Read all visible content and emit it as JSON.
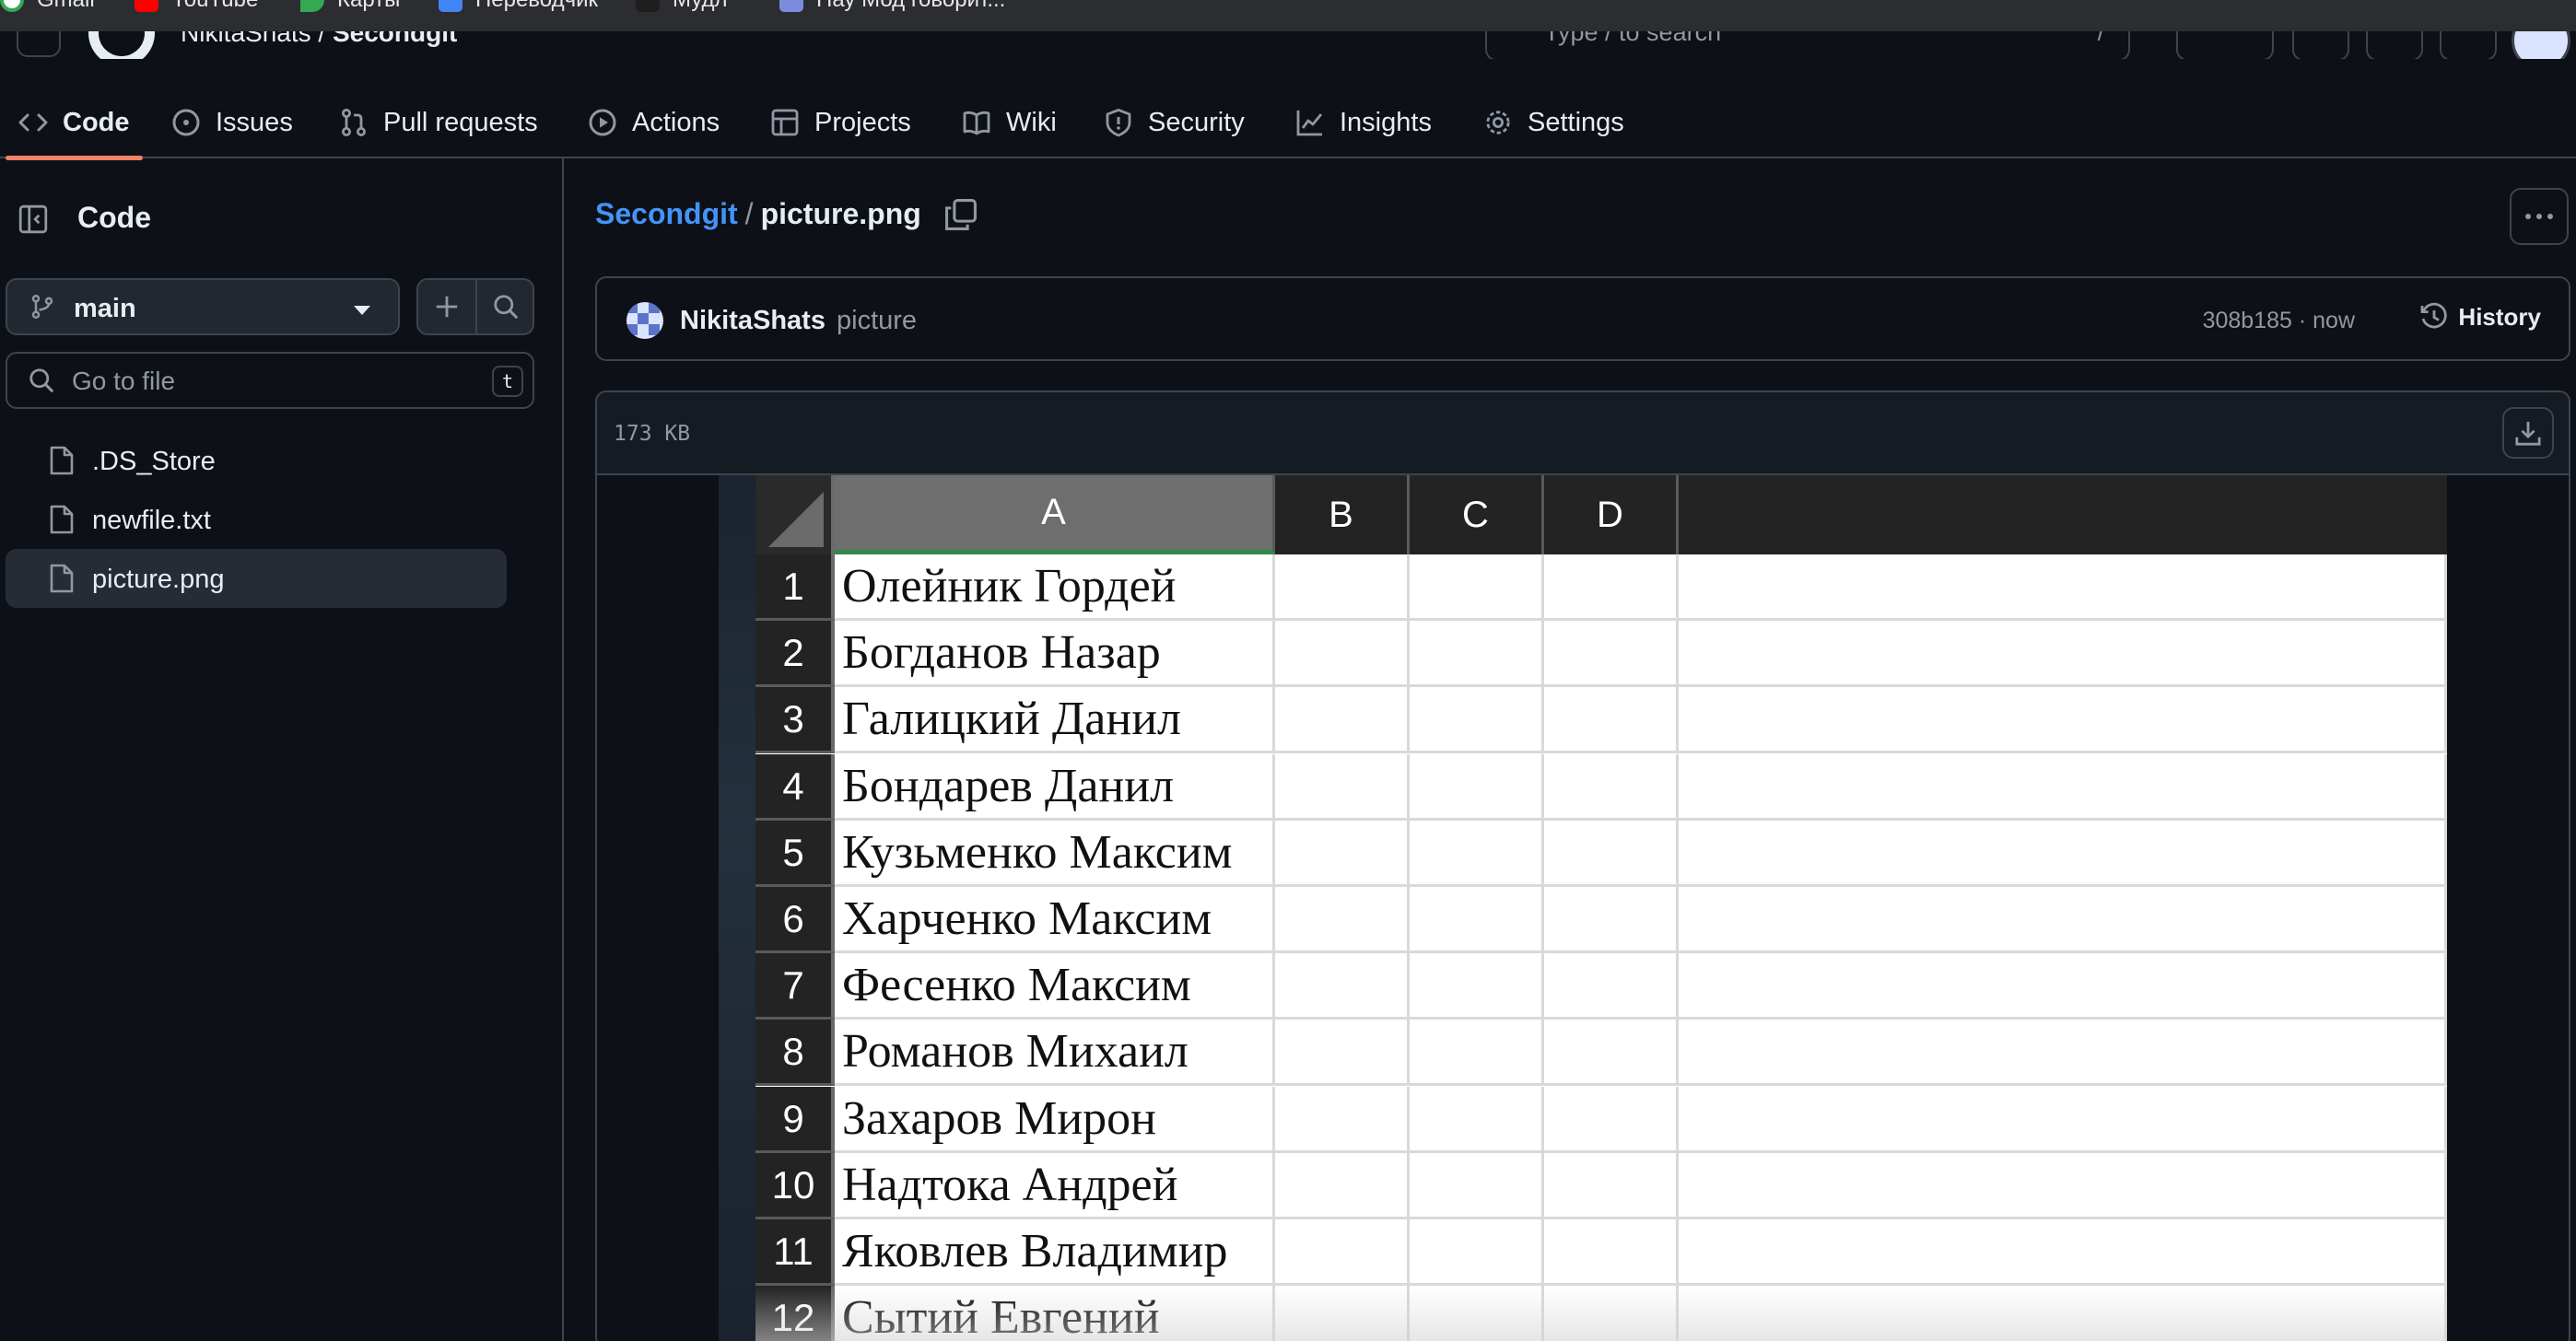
{
  "bookmarks": [
    {
      "label": "Gmail",
      "color": "#ffffff"
    },
    {
      "label": "YouTube",
      "color": "#ff0000"
    },
    {
      "label": "Карты",
      "color": "#34a853"
    },
    {
      "label": "Переводчик",
      "color": "#4285f4"
    },
    {
      "label": "Мудл",
      "color": "#1e1e1e"
    },
    {
      "label": "Нау Мод говорит...",
      "color": "#7b8cde"
    }
  ],
  "header": {
    "owner": "NikitaShats",
    "separator": "/",
    "repo": "Secondgit",
    "search_placeholder": "Type / to search",
    "search_shortcut": "/"
  },
  "repo_nav": {
    "tabs": [
      {
        "label": "Code",
        "icon": "code-icon",
        "active": true
      },
      {
        "label": "Issues",
        "icon": "issue-icon"
      },
      {
        "label": "Pull requests",
        "icon": "pull-request-icon"
      },
      {
        "label": "Actions",
        "icon": "play-icon"
      },
      {
        "label": "Projects",
        "icon": "table-icon"
      },
      {
        "label": "Wiki",
        "icon": "book-icon"
      },
      {
        "label": "Security",
        "icon": "shield-icon"
      },
      {
        "label": "Insights",
        "icon": "graph-icon"
      },
      {
        "label": "Settings",
        "icon": "gear-icon"
      }
    ]
  },
  "sidebar": {
    "title": "Code",
    "branch": "main",
    "goto_placeholder": "Go to file",
    "goto_shortcut": "t",
    "files": [
      {
        "name": ".DS_Store",
        "selected": false
      },
      {
        "name": "newfile.txt",
        "selected": false
      },
      {
        "name": "picture.png",
        "selected": true
      }
    ]
  },
  "main": {
    "repo_link": "Secondgit",
    "path_separator": "/",
    "file_name": "picture.png",
    "commit": {
      "author": "NikitaShats",
      "message": "picture",
      "meta": "308b185 · now",
      "history_label": "History"
    },
    "file_size": "173 KB"
  },
  "picture": {
    "columns": [
      "A",
      "B",
      "C",
      "D"
    ],
    "selected_column": "A",
    "rows": [
      {
        "num": "1",
        "name": "Олейник Гордей"
      },
      {
        "num": "2",
        "name": "Богданов Назар"
      },
      {
        "num": "3",
        "name": "Галицкий Данил"
      },
      {
        "num": "4",
        "name": "Бондарев Данил"
      },
      {
        "num": "5",
        "name": "Кузьменко Максим"
      },
      {
        "num": "6",
        "name": "Харченко Максим"
      },
      {
        "num": "7",
        "name": "Фесенко Максим"
      },
      {
        "num": "8",
        "name": "Романов Михаил"
      },
      {
        "num": "9",
        "name": "Захаров Мирон"
      },
      {
        "num": "10",
        "name": "Надтока Андрей"
      },
      {
        "num": "11",
        "name": "Яковлев Владимир"
      },
      {
        "num": "12",
        "name": "Сытий Евгений"
      }
    ]
  },
  "colors": {
    "accent_link": "#4493f8",
    "active_tab_underline": "#f78166",
    "background": "#0d1117"
  }
}
